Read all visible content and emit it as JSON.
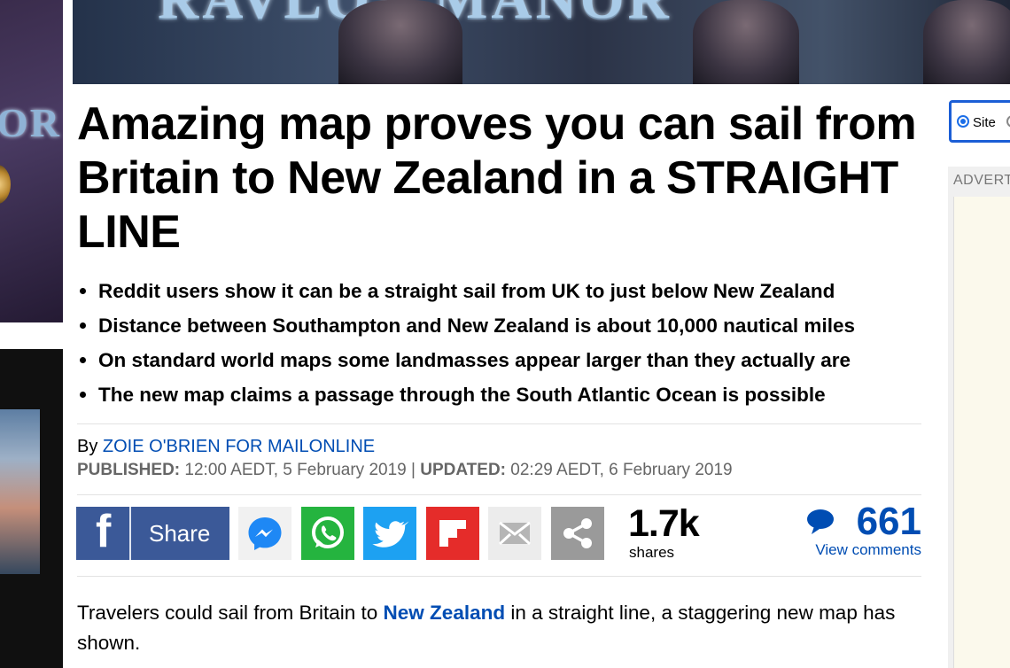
{
  "banner": {
    "title_fragment": "RAVLOV MANOR"
  },
  "left_ad": {
    "logo_fragment": "OR"
  },
  "article": {
    "headline": "Amazing map proves you can sail from Britain to New Zealand in a STRAIGHT LINE",
    "bullets": [
      "Reddit users show it can be a straight sail from UK to just below New Zealand",
      "Distance between Southampton and New Zealand is about 10,000 nautical miles",
      "On standard world maps some landmasses appear larger than they actually are",
      "The new map claims a passage through the South Atlantic Ocean is possible"
    ],
    "byline_prefix": "By",
    "author": "ZOIE O'BRIEN FOR MAILONLINE",
    "published_label": "PUBLISHED:",
    "published_value": "12:00 AEDT, 5 February 2019",
    "separator": "|",
    "updated_label": "UPDATED:",
    "updated_value": "02:29 AEDT, 6 February 2019",
    "body_before_link": "Travelers could sail from Britain to",
    "body_link": "New Zealand",
    "body_after_link": "in a straight line, a staggering new map has shown."
  },
  "share": {
    "facebook_label": "Share",
    "icons": [
      "facebook-icon",
      "messenger-icon",
      "whatsapp-icon",
      "twitter-icon",
      "flipboard-icon",
      "email-icon",
      "more-share-icon"
    ],
    "count": "1.7k",
    "count_label": "shares"
  },
  "comments": {
    "count": "661",
    "link_label": "View comments"
  },
  "sidebar": {
    "search_option_site": "Site",
    "advert_label": "ADVERT"
  },
  "colors": {
    "link_blue": "#004db3",
    "facebook": "#3b5998",
    "whatsapp": "#25b43f",
    "twitter": "#1da1f2",
    "flipboard": "#e52c2a"
  }
}
